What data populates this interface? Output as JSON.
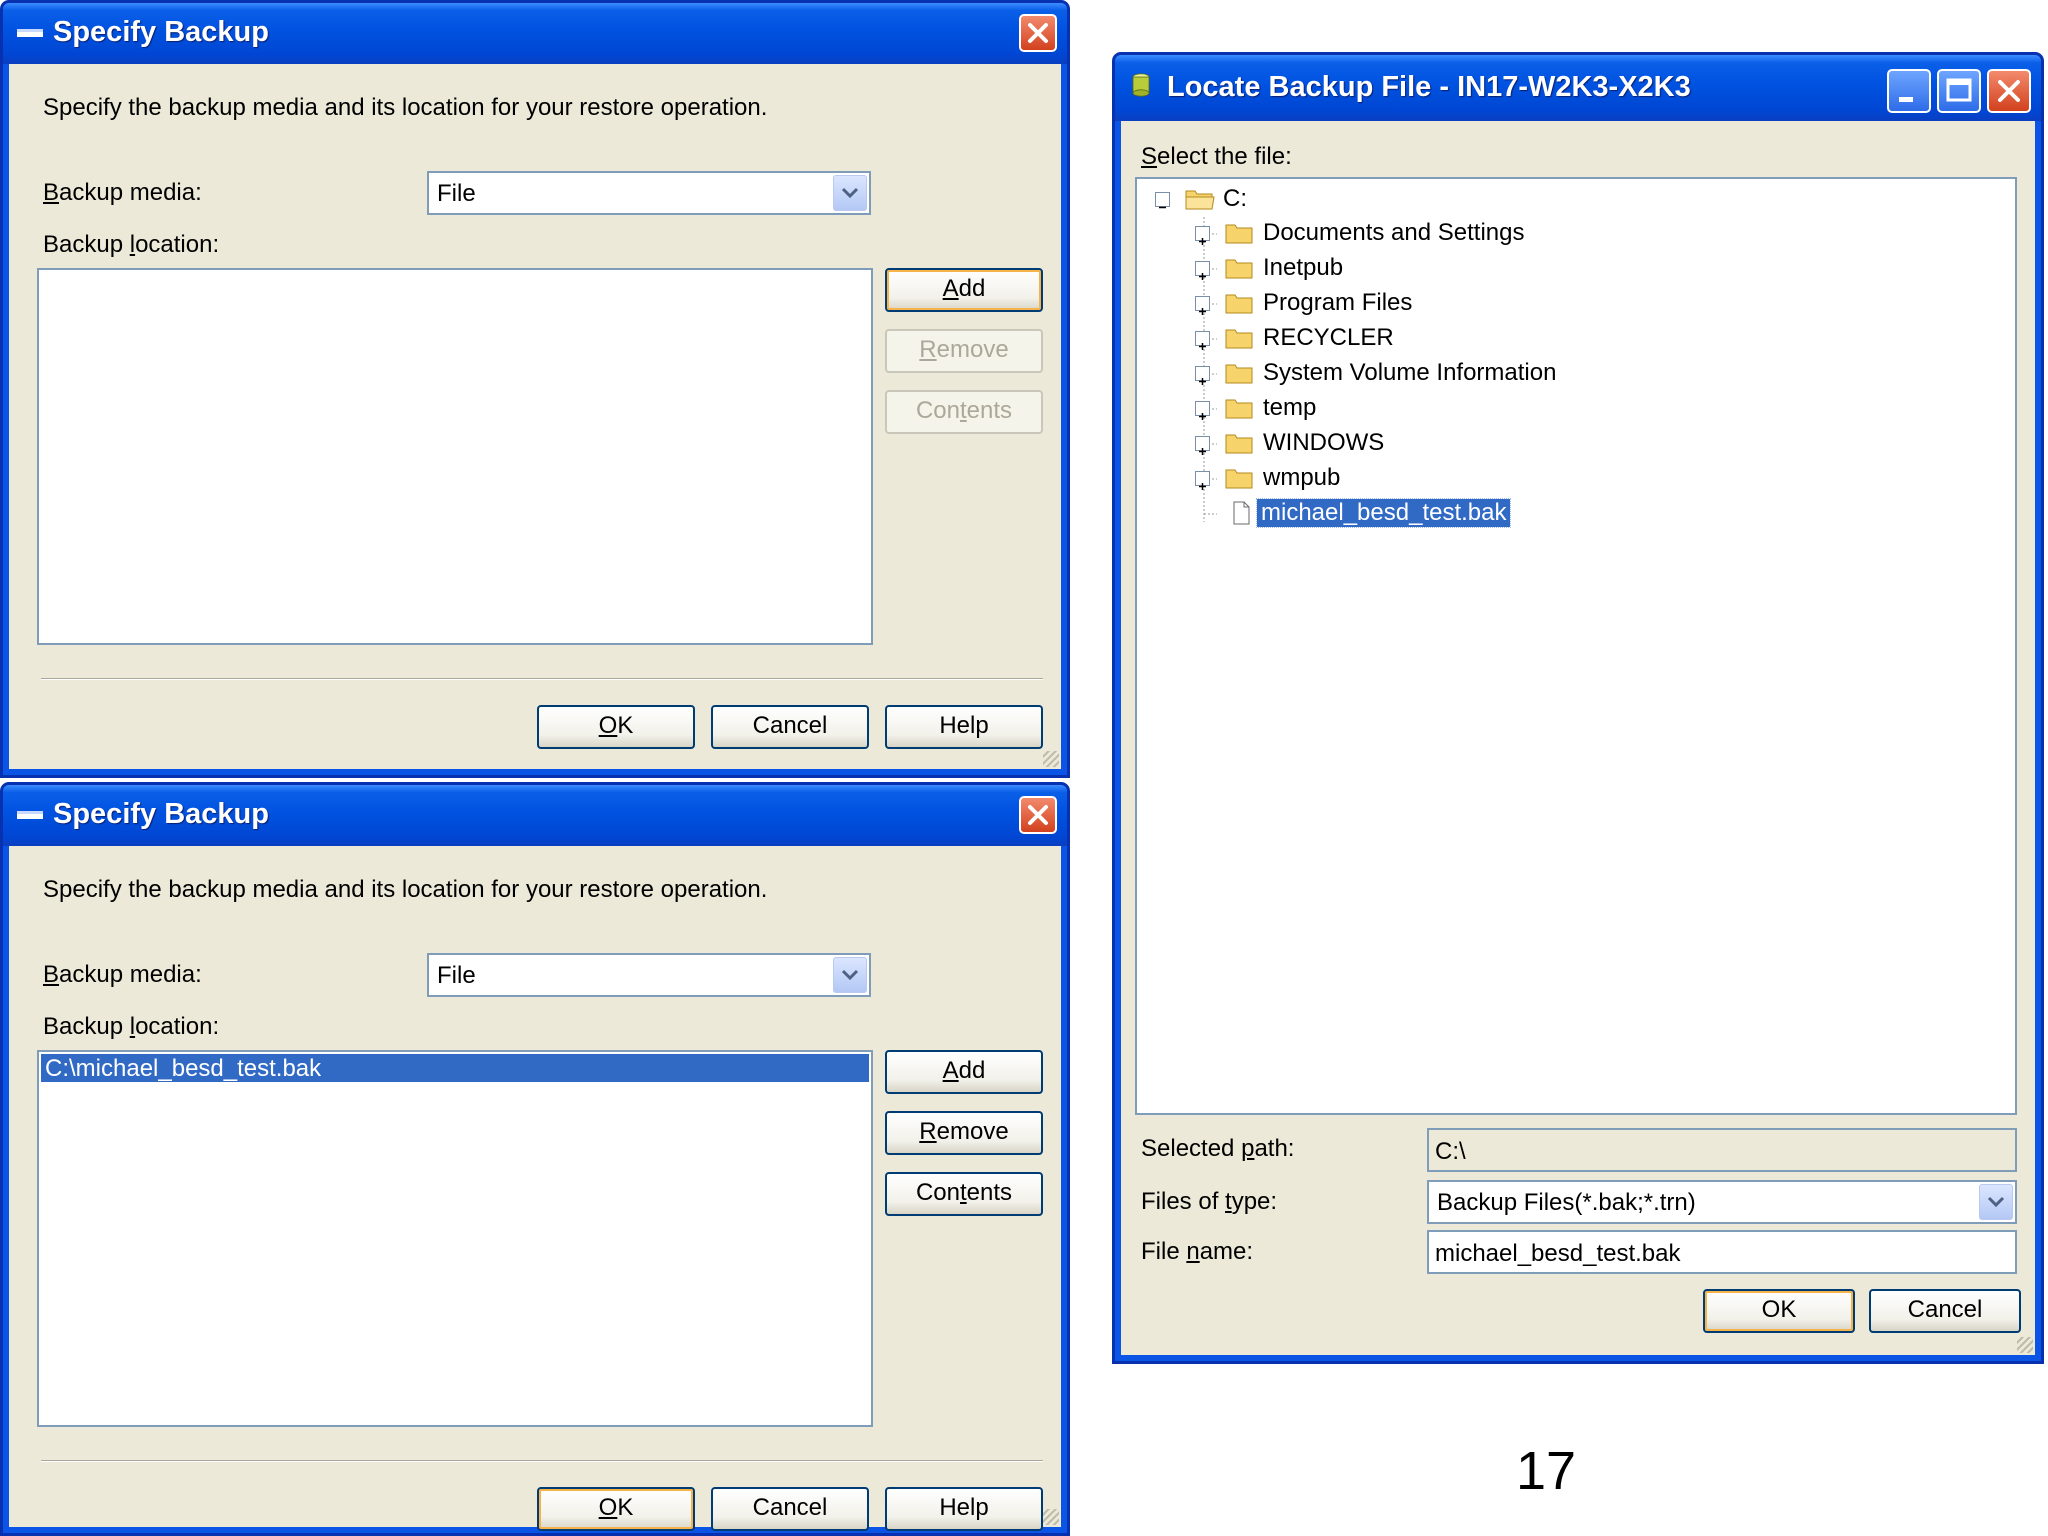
{
  "dialog_top": {
    "title": "Specify Backup",
    "instruction": "Specify the backup media and its location for your restore operation.",
    "backup_media_label_key": "B",
    "backup_media_label_rest": "ackup media:",
    "backup_media_value": "File",
    "backup_location_label_pre": "Backup ",
    "backup_location_label_key": "l",
    "backup_location_label_rest": "ocation:",
    "add_key": "A",
    "add_rest": "dd",
    "remove_key": "R",
    "remove_rest": "emove",
    "contents_pre": "Con",
    "contents_key": "t",
    "contents_rest": "ents",
    "ok_key": "O",
    "ok_rest": "K",
    "cancel": "Cancel",
    "help": "Help"
  },
  "dialog_bottom": {
    "title": "Specify Backup",
    "instruction": "Specify the backup media and its location for your restore operation.",
    "backup_media_label_key": "B",
    "backup_media_label_rest": "ackup media:",
    "backup_media_value": "File",
    "backup_location_label_pre": "Backup ",
    "backup_location_label_key": "l",
    "backup_location_label_rest": "ocation:",
    "location_item": "C:\\michael_besd_test.bak",
    "add_key": "A",
    "add_rest": "dd",
    "remove_key": "R",
    "remove_rest": "emove",
    "contents_pre": "Con",
    "contents_key": "t",
    "contents_rest": "ents",
    "ok_key": "O",
    "ok_rest": "K",
    "cancel": "Cancel",
    "help": "Help"
  },
  "locate_dialog": {
    "title": "Locate Backup File - IN17-W2K3-X2K3",
    "select_file_key": "S",
    "select_file_rest": "elect the file:",
    "tree_root": "C:",
    "tree_folders": [
      "Documents and Settings",
      "Inetpub",
      "Program Files",
      "RECYCLER",
      "System Volume Information",
      "temp",
      "WINDOWS",
      "wmpub"
    ],
    "tree_file": "michael_besd_test.bak",
    "selected_path_label_pre": "Selected ",
    "selected_path_label_key": "p",
    "selected_path_label_rest": "ath:",
    "selected_path_value": "C:\\",
    "files_of_type_label_pre": "Files of ",
    "files_of_type_label_key": "t",
    "files_of_type_label_rest": "ype:",
    "files_of_type_value": "Backup Files(*.bak;*.trn)",
    "file_name_label_pre": "File ",
    "file_name_label_key": "n",
    "file_name_label_rest": "ame:",
    "file_name_value": "michael_besd_test.bak",
    "ok": "OK",
    "cancel": "Cancel"
  },
  "page_number": "17",
  "colors": {
    "titlebar": "#0054e3",
    "selection": "#316ac5",
    "dialog_bg": "#ece9d8"
  }
}
